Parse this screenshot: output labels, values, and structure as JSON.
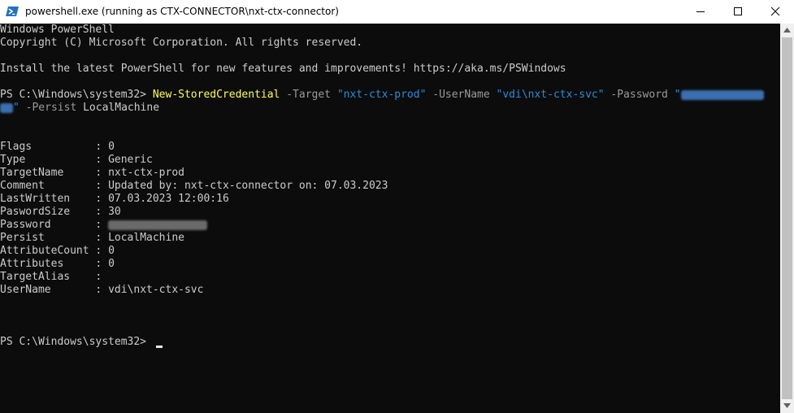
{
  "window": {
    "title": "powershell.exe (running as CTX-CONNECTOR\\nxt-ctx-connector)",
    "icon": "powershell-icon",
    "controls": [
      "minimize-icon",
      "maximize-icon",
      "close-icon"
    ]
  },
  "console": {
    "banner": [
      "Windows PowerShell",
      "Copyright (C) Microsoft Corporation. All rights reserved.",
      "Install the latest PowerShell for new features and improvements! https://aka.ms/PSWindows"
    ],
    "command": {
      "prompt": "PS C:\\Windows\\system32> ",
      "cmdlet": "New-StoredCredential",
      "p_target": " -Target ",
      "v_target": "\"nxt-ctx-prod\"",
      "p_username": " -UserName ",
      "v_username": "\"vdi\\nxt-ctx-svc\"",
      "p_password": " -Password ",
      "v_password_open": "\"",
      "v_password_close": "\"",
      "p_persist": " -Persist ",
      "v_persist": "LocalMachine"
    },
    "output": [
      {
        "key": "Flags         ",
        "value": "0"
      },
      {
        "key": "Type          ",
        "value": "Generic"
      },
      {
        "key": "TargetName    ",
        "value": "nxt-ctx-prod"
      },
      {
        "key": "Comment       ",
        "value": "Updated by: nxt-ctx-connector on: 07.03.2023"
      },
      {
        "key": "LastWritten   ",
        "value": "07.03.2023 12:00:16"
      },
      {
        "key": "PaswordSize   ",
        "value": "30"
      },
      {
        "key": "Password      ",
        "value": ""
      },
      {
        "key": "Persist       ",
        "value": "LocalMachine"
      },
      {
        "key": "AttributeCount",
        "value": "0"
      },
      {
        "key": "Attributes    ",
        "value": "0"
      },
      {
        "key": "TargetAlias   ",
        "value": ""
      },
      {
        "key": "UserName      ",
        "value": "vdi\\nxt-ctx-svc"
      }
    ],
    "separator": " : ",
    "final_prompt": "PS C:\\Windows\\system32> "
  },
  "colors": {
    "background": "#0c0c0c",
    "text": "#cccccc",
    "cmdlet": "#ffff55",
    "parameter": "#9a9a9a",
    "string": "#2b8cd8"
  }
}
